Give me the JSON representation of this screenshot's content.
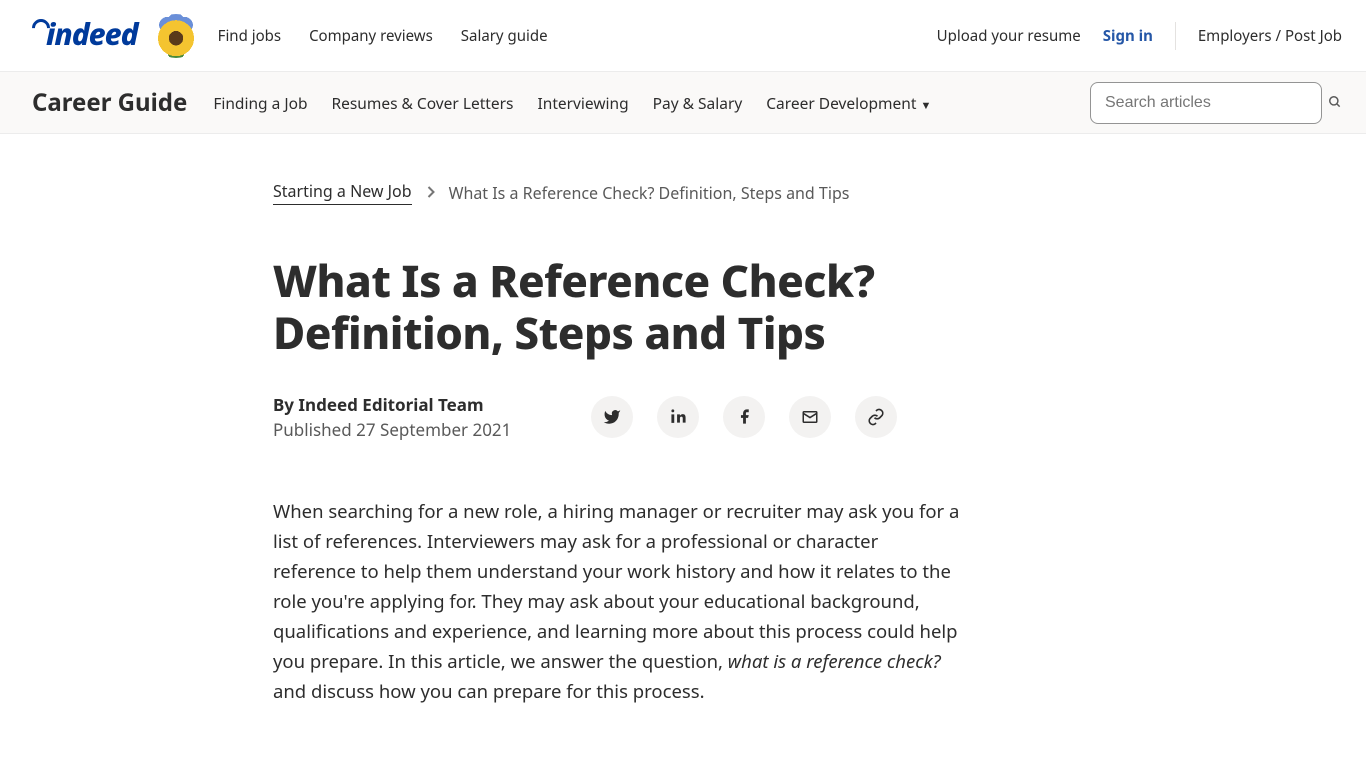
{
  "topnav": {
    "logo_text": "indeed",
    "links": [
      "Find jobs",
      "Company reviews",
      "Salary guide"
    ],
    "upload": "Upload your resume",
    "signin": "Sign in",
    "employers": "Employers / Post Job"
  },
  "subnav": {
    "title": "Career Guide",
    "links": [
      "Finding a Job",
      "Resumes & Cover Letters",
      "Interviewing",
      "Pay & Salary",
      "Career Development"
    ],
    "search_placeholder": "Search articles"
  },
  "breadcrumb": {
    "parent": "Starting a New Job",
    "current": "What Is a Reference Check? Definition, Steps and Tips"
  },
  "article": {
    "title": "What Is a Reference Check? Definition, Steps and Tips",
    "author": "By Indeed Editorial Team",
    "published": "Published 27 September 2021",
    "body_before_em": "When searching for a new role, a hiring manager or recruiter may ask you for a list of references. Interviewers may ask for a professional or character reference to help them understand your work history and how it relates to the role you're applying for. They may ask about your educational background, qualifications and experience, and learning more about this process could help you prepare. In this article, we answer the question, ",
    "body_em": "what is a reference check?",
    "body_after_em": " and discuss how you can prepare for this process."
  }
}
